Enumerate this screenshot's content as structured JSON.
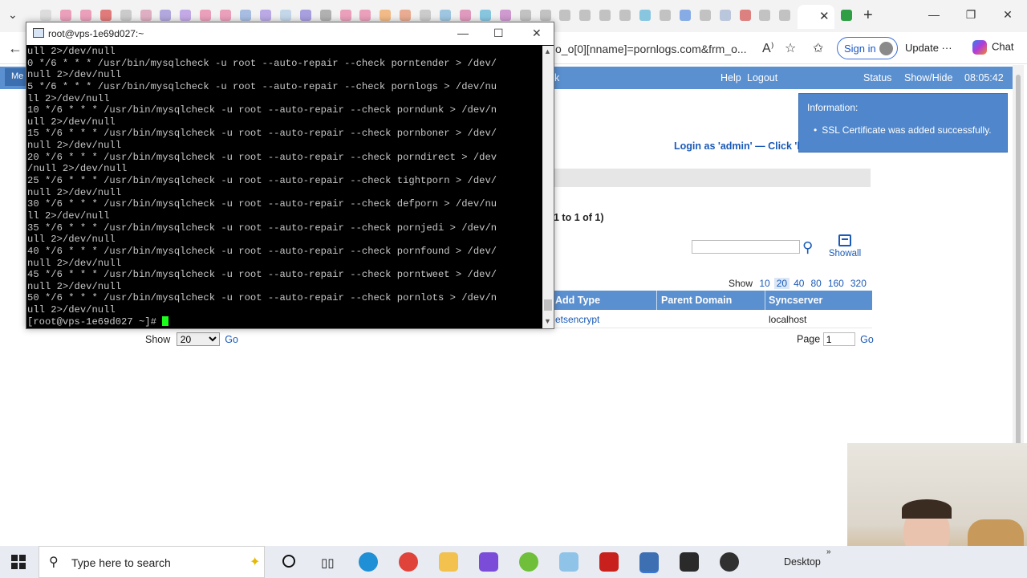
{
  "browser": {
    "url_fragment": "o_o[0][nname]=pornlogs.com&frm_o...",
    "signin_label": "Sign in",
    "update_label": "Update",
    "chat_label": "Chat"
  },
  "page": {
    "menu_label": "Me",
    "topbar": {
      "left_fragment": "k",
      "help": "Help",
      "logout": "Logout",
      "status": "Status",
      "showhide": "Show/Hide",
      "clock": "08:05:42"
    },
    "info": {
      "title": "Information:",
      "message": "SSL Certificate was added successfully."
    },
    "login_link": "Login as 'admin' — Click 'l",
    "range_text": "1 to 1 of 1)",
    "showall_label": "Showall",
    "page_sizes_label": "Show",
    "page_sizes": [
      "10",
      "20",
      "40",
      "80",
      "160",
      "320"
    ],
    "selected_page_size": "20",
    "table": {
      "headers": [
        "Add Type",
        "Parent Domain",
        "Syncserver"
      ],
      "rows": [
        {
          "type": "etsencrypt",
          "parent": "",
          "sync": "localhost"
        }
      ]
    },
    "show_select": {
      "label": "Show",
      "value": "20",
      "go": "Go"
    },
    "page_input": {
      "label": "Page",
      "value": "1",
      "go": "Go"
    }
  },
  "terminal": {
    "title": "root@vps-1e69d027:~",
    "lines": [
      "ull 2>/dev/null",
      "0 */6 * * * /usr/bin/mysqlcheck -u root --auto-repair --check porntender > /dev/",
      "null 2>/dev/null",
      "5 */6 * * * /usr/bin/mysqlcheck -u root --auto-repair --check pornlogs > /dev/nu",
      "ll 2>/dev/null",
      "10 */6 * * * /usr/bin/mysqlcheck -u root --auto-repair --check porndunk > /dev/n",
      "ull 2>/dev/null",
      "15 */6 * * * /usr/bin/mysqlcheck -u root --auto-repair --check pornboner > /dev/",
      "null 2>/dev/null",
      "20 */6 * * * /usr/bin/mysqlcheck -u root --auto-repair --check porndirect > /dev",
      "/null 2>/dev/null",
      "25 */6 * * * /usr/bin/mysqlcheck -u root --auto-repair --check tightporn > /dev/",
      "null 2>/dev/null",
      "30 */6 * * * /usr/bin/mysqlcheck -u root --auto-repair --check defporn > /dev/nu",
      "ll 2>/dev/null",
      "35 */6 * * * /usr/bin/mysqlcheck -u root --auto-repair --check pornjedi > /dev/n",
      "ull 2>/dev/null",
      "40 */6 * * * /usr/bin/mysqlcheck -u root --auto-repair --check pornfound > /dev/",
      "null 2>/dev/null",
      "45 */6 * * * /usr/bin/mysqlcheck -u root --auto-repair --check porntweet > /dev/",
      "null 2>/dev/null",
      "50 */6 * * * /usr/bin/mysqlcheck -u root --auto-repair --check pornlots > /dev/n",
      "ull 2>/dev/null"
    ],
    "prompt": "[root@vps-1e69d027 ~]# "
  },
  "taskbar": {
    "search_placeholder": "Type here to search",
    "desktop_label": "Desktop",
    "apps": [
      {
        "name": "edge",
        "color": "#1f8fd6"
      },
      {
        "name": "chrome",
        "color": "#e0433a"
      },
      {
        "name": "file-explorer",
        "color": "#f2c14e"
      },
      {
        "name": "copilot",
        "color": "#7a4cd8"
      },
      {
        "name": "utorrent",
        "color": "#6fbf3a"
      },
      {
        "name": "notepad",
        "color": "#8fc3e8"
      },
      {
        "name": "filezilla",
        "color": "#c8201c"
      },
      {
        "name": "rdp",
        "color": "#3d6fb3"
      },
      {
        "name": "vnc",
        "color": "#2a2a2a"
      },
      {
        "name": "obs",
        "color": "#303030"
      }
    ]
  },
  "colors": {
    "da_blue": "#5a8fd0",
    "link": "#1a5ab8",
    "terminal_bg": "#000000",
    "terminal_fg": "#c8c8c8",
    "cursor": "#1aff1a"
  }
}
